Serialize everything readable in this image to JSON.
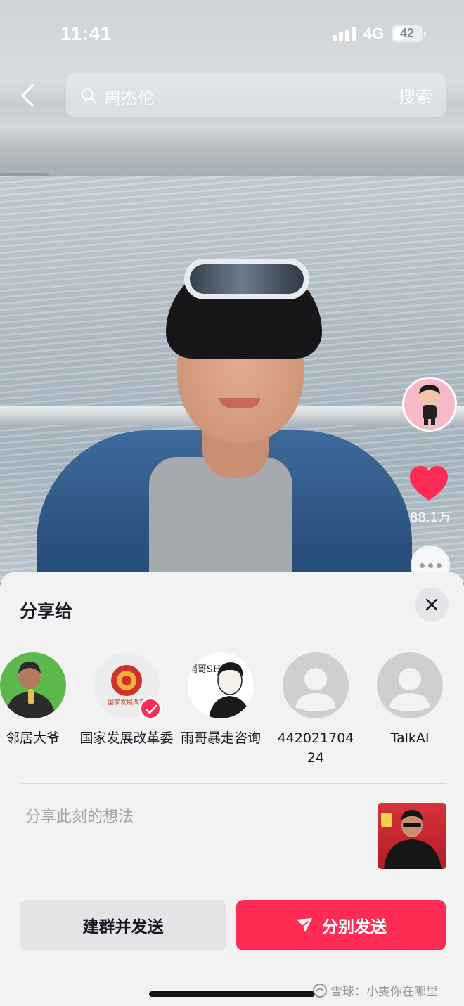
{
  "status_bar": {
    "time": "11:41",
    "network": "4G",
    "battery": "42",
    "battery_level": 0.42
  },
  "header": {
    "search_query": "周杰伦",
    "search_button": "搜索"
  },
  "right_rail": {
    "like_count": "88.1万",
    "colors": {
      "like": "#fe2c55"
    }
  },
  "share_sheet": {
    "title": "分享给",
    "contacts": [
      {
        "name": "邻居大爷",
        "avatar": "photo"
      },
      {
        "name": "国家发展改革委",
        "avatar": "emblem",
        "avatar_text": "国家发展改革",
        "selected": true
      },
      {
        "name": "雨哥暴走咨询",
        "avatar": "illustration",
        "avatar_text": "雨哥SH"
      },
      {
        "name": "44202170424",
        "avatar": "default-user-icon"
      },
      {
        "name": "TalkAI",
        "avatar": "default-user-icon"
      }
    ],
    "thought_placeholder": "分享此刻的想法",
    "group_send_label": "建群并发送",
    "send_separately_label": "分别发送",
    "colors": {
      "primary": "#fe2c55",
      "sheet_bg": "#f2f2f3"
    }
  },
  "watermark": "雪球：小雯你在哪里"
}
